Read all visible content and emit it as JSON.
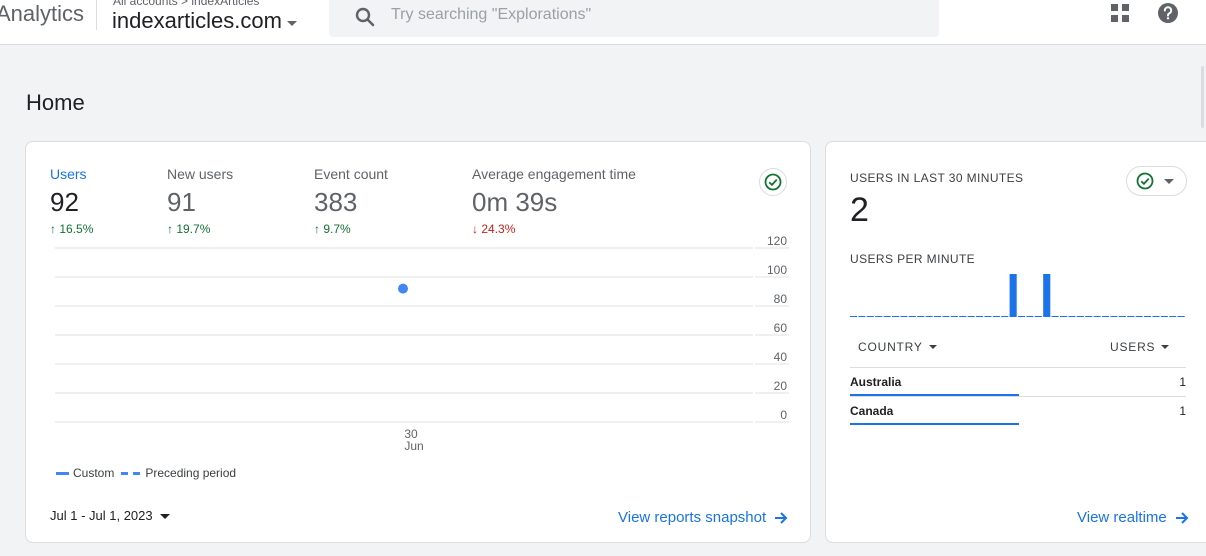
{
  "header": {
    "brand": "Analytics",
    "breadcrumb": "All accounts > indexArticles",
    "property": "indexarticles.com",
    "search_placeholder": "Try searching \"Explorations\""
  },
  "page": {
    "title": "Home"
  },
  "metrics": [
    {
      "label": "Users",
      "value": "92",
      "change": "16.5%",
      "direction": "up"
    },
    {
      "label": "New users",
      "value": "91",
      "change": "19.7%",
      "direction": "up"
    },
    {
      "label": "Event count",
      "value": "383",
      "change": "9.7%",
      "direction": "up"
    },
    {
      "label": "Average engagement time",
      "value": "0m 39s",
      "change": "24.3%",
      "direction": "down"
    }
  ],
  "arrows": {
    "up": "↑",
    "down": "↓"
  },
  "chart_data": {
    "type": "scatter",
    "x_ticks": [
      {
        "day": "30",
        "month": "Jun"
      }
    ],
    "y_ticks": [
      120,
      100,
      80,
      60,
      40,
      20,
      0
    ],
    "ylim": [
      0,
      120
    ],
    "series": [
      {
        "name": "Custom",
        "points": [
          {
            "x": "30 Jun",
            "y": 92
          }
        ]
      }
    ],
    "legend": [
      "Custom",
      "Preceding period"
    ],
    "grid": true
  },
  "date_range": "Jul 1 - Jul 1, 2023",
  "links": {
    "reports": "View reports snapshot",
    "realtime": "View realtime"
  },
  "realtime": {
    "heading": "USERS IN LAST 30 MINUTES",
    "value": "2",
    "per_minute_heading": "USERS PER MINUTE",
    "per_minute": [
      0,
      0,
      0,
      0,
      0,
      0,
      0,
      0,
      0,
      0,
      0,
      0,
      0,
      0,
      0,
      0,
      0,
      0,
      0,
      1,
      0,
      0,
      0,
      1,
      0,
      0,
      0,
      0,
      0,
      0,
      0,
      0,
      0,
      0,
      0,
      0,
      0,
      0,
      0,
      0
    ],
    "columns": [
      "COUNTRY",
      "USERS"
    ],
    "rows": [
      {
        "country": "Australia",
        "users": "1"
      },
      {
        "country": "Canada",
        "users": "1"
      }
    ]
  },
  "colors": {
    "accent": "#1a73e8",
    "series": "#4285f4",
    "positive": "#137333",
    "negative": "#c5221f"
  }
}
